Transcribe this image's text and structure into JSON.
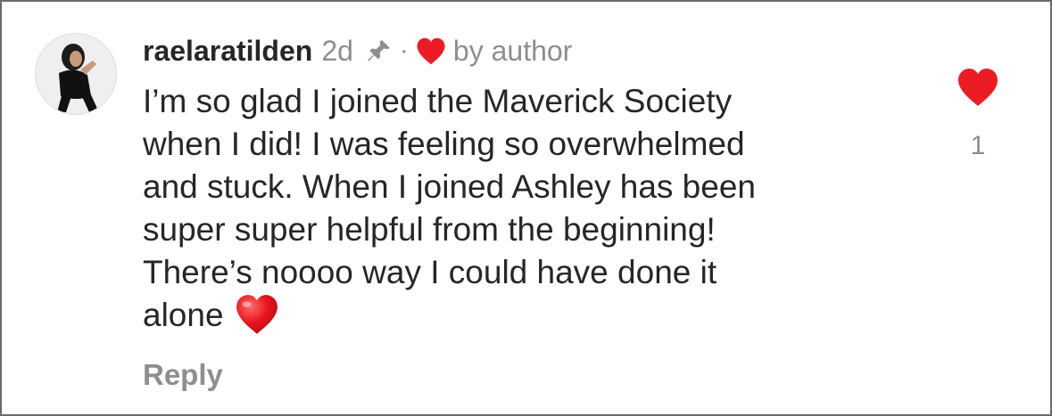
{
  "comment": {
    "username": "raelaratilden",
    "time": "2d",
    "separator": "·",
    "author_badge": "by author",
    "text_lines": [
      "I’m so glad I joined the Maverick Society",
      "when I did! I was feeling so overwhelmed",
      "and stuck. When I joined Ashley has been",
      "super super helpful from the beginning!",
      "There’s noooo way I could have done it",
      "alone"
    ],
    "reply_label": "Reply",
    "like_count": "1"
  },
  "icons": {
    "pin": "pin-icon",
    "author_like": "heart-icon",
    "inline_emoji": "red-heart-emoji-icon",
    "like_button": "heart-icon"
  },
  "colors": {
    "heart_red": "#ed1c24",
    "text": "#262626",
    "secondary": "#8e8e8e"
  }
}
